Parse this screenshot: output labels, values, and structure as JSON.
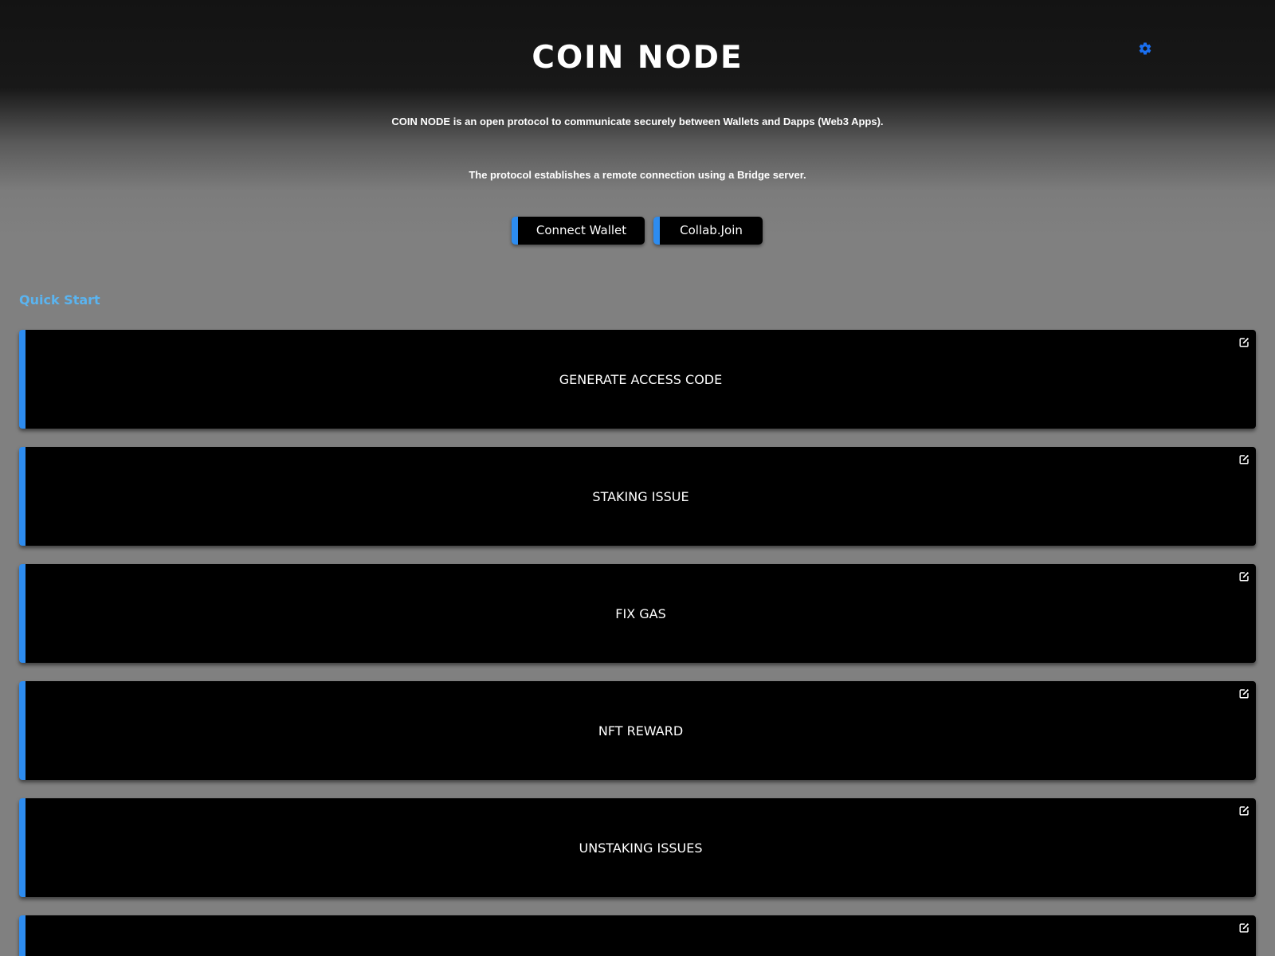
{
  "header": {
    "title": "COIN NODE",
    "settings_icon": "gear-icon",
    "accent_color": "#1a6ff0"
  },
  "description": {
    "line1": "COIN NODE is an open protocol to communicate securely between Wallets and Dapps (Web3 Apps).",
    "line2": "The protocol establishes a remote connection using a Bridge server."
  },
  "actions": {
    "connect_label": "Connect Wallet",
    "collab_label": "Collab.Join",
    "accent_color": "#2d8cf0"
  },
  "quick_start": {
    "label": "Quick Start",
    "color": "#5ab4f0"
  },
  "cards": [
    {
      "label": "GENERATE ACCESS CODE",
      "icon": "edit-icon"
    },
    {
      "label": "STAKING ISSUE",
      "icon": "edit-icon"
    },
    {
      "label": "FIX GAS",
      "icon": "edit-icon"
    },
    {
      "label": "NFT REWARD",
      "icon": "edit-icon"
    },
    {
      "label": "UNSTAKING ISSUES",
      "icon": "edit-icon"
    },
    {
      "label": "",
      "icon": "edit-icon"
    }
  ]
}
